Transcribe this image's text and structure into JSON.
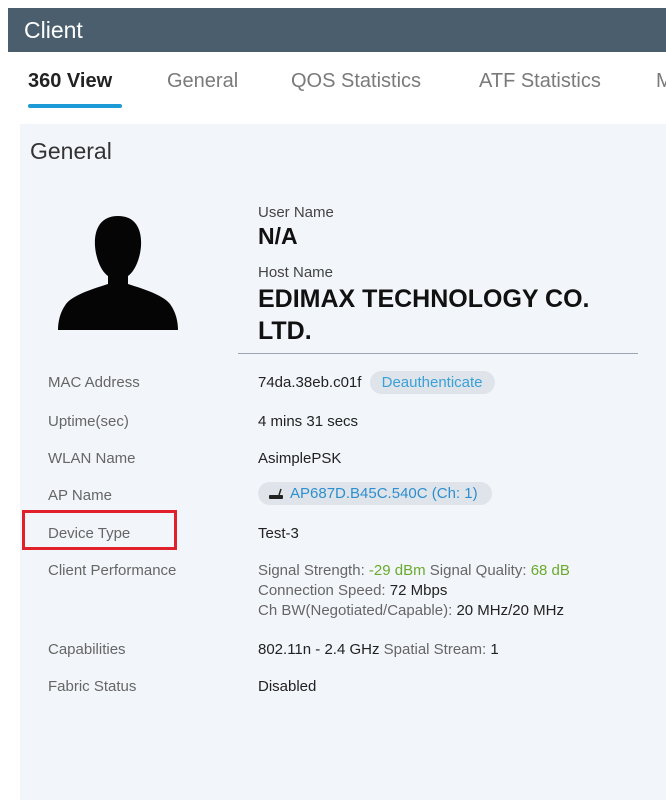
{
  "header": {
    "title": "Client"
  },
  "tabs": [
    {
      "label": "360 View"
    },
    {
      "label": "General"
    },
    {
      "label": "QOS Statistics"
    },
    {
      "label": "ATF Statistics"
    },
    {
      "label": "M"
    }
  ],
  "general": {
    "title": "General",
    "user_name_label": "User Name",
    "user_name_value": "N/A",
    "host_name_label": "Host Name",
    "host_name_value": "EDIMAX TECHNOLOGY CO. LTD.",
    "rows": {
      "mac_address": {
        "label": "MAC Address",
        "value": "74da.38eb.c01f",
        "action": "Deauthenticate"
      },
      "uptime": {
        "label": "Uptime(sec)",
        "value": "4 mins 31 secs"
      },
      "wlan_name": {
        "label": "WLAN Name",
        "value": "AsimplePSK"
      },
      "ap_name": {
        "label": "AP Name",
        "value": "AP687D.B45C.540C (Ch: 1)"
      },
      "device_type": {
        "label": "Device Type",
        "value": "Test-3"
      },
      "client_performance": {
        "label": "Client Performance",
        "signal_strength_label": "Signal Strength:",
        "signal_strength_value": "-29 dBm",
        "signal_quality_label": "Signal Quality:",
        "signal_quality_value": "68 dB",
        "connection_speed_label": "Connection Speed:",
        "connection_speed_value": "72 Mbps",
        "ch_bw_label": "Ch BW(Negotiated/Capable):",
        "ch_bw_value": "20 MHz/20 MHz"
      },
      "capabilities": {
        "label": "Capabilities",
        "value": "802.11n - 2.4 GHz",
        "spatial_label": "Spatial Stream:",
        "spatial_value": "1"
      },
      "fabric_status": {
        "label": "Fabric Status",
        "value": "Disabled"
      }
    }
  },
  "colors": {
    "header_bg": "#4a5e6e",
    "tab_accent": "#1d9bd7",
    "highlight": "#e0202a",
    "good_value": "#6aaa2e",
    "link": "#2d8fd0"
  },
  "icons": {
    "avatar": "user-silhouette-icon",
    "ap": "access-point-icon"
  }
}
